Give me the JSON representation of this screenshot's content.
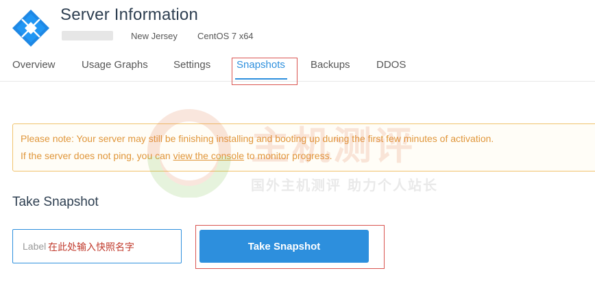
{
  "header": {
    "title": "Server Information",
    "location": "New Jersey",
    "os": "CentOS 7 x64"
  },
  "tabs": [
    {
      "label": "Overview",
      "active": false
    },
    {
      "label": "Usage Graphs",
      "active": false
    },
    {
      "label": "Settings",
      "active": false
    },
    {
      "label": "Snapshots",
      "active": true
    },
    {
      "label": "Backups",
      "active": false
    },
    {
      "label": "DDOS",
      "active": false
    }
  ],
  "notice": {
    "line1": "Please note: Your server may still be finishing installing and booting up during the first few minutes of activation.",
    "line2_before": "If the server does not ping, you can ",
    "line2_link": "view the console",
    "line2_after": " to monitor progress."
  },
  "watermark": {
    "title": "主机测评",
    "subtitle": "国外主机测评 助力个人站长"
  },
  "snapshot": {
    "section_title": "Take Snapshot",
    "label_placeholder": "Label",
    "label_annotation": "在此处输入快照名字",
    "button_label": "Take Snapshot"
  },
  "colors": {
    "accent": "#2d8fdd",
    "notice_text": "#e0963a",
    "notice_border": "#f0c36d",
    "highlight": "#d9534f"
  }
}
